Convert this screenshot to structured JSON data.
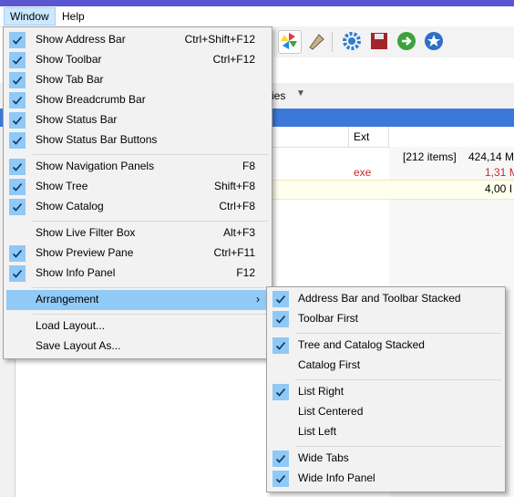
{
  "menubar": {
    "items": [
      {
        "label": "Window"
      },
      {
        "label": "Help"
      }
    ]
  },
  "background": {
    "tab_fragment": "ies",
    "column_ext": "Ext",
    "summary_count": "[212 items]",
    "summary_size": "424,14 M",
    "row1_ext": "exe",
    "row1_size": "1,31 M",
    "row2_size": "4,00 I",
    "accent_red": "#cc2a2a"
  },
  "window_menu": {
    "items": [
      {
        "label": "Show Address Bar",
        "shortcut": "Ctrl+Shift+F12",
        "checked": true
      },
      {
        "label": "Show Toolbar",
        "shortcut": "Ctrl+F12",
        "checked": true
      },
      {
        "label": "Show Tab Bar",
        "shortcut": "",
        "checked": true
      },
      {
        "label": "Show Breadcrumb Bar",
        "shortcut": "",
        "checked": true
      },
      {
        "label": "Show Status Bar",
        "shortcut": "",
        "checked": true
      },
      {
        "label": "Show Status Bar Buttons",
        "shortcut": "",
        "checked": true
      },
      {
        "label": "Show Navigation Panels",
        "shortcut": "F8",
        "checked": true
      },
      {
        "label": "Show Tree",
        "shortcut": "Shift+F8",
        "checked": true
      },
      {
        "label": "Show Catalog",
        "shortcut": "Ctrl+F8",
        "checked": true
      },
      {
        "label": "Show Live Filter Box",
        "shortcut": "Alt+F3",
        "checked": false
      },
      {
        "label": "Show Preview Pane",
        "shortcut": "Ctrl+F11",
        "checked": true
      },
      {
        "label": "Show Info Panel",
        "shortcut": "F12",
        "checked": true
      },
      {
        "label": "Arrangement",
        "shortcut": "",
        "checked": false,
        "submenu": true
      },
      {
        "label": "Load Layout...",
        "shortcut": "",
        "checked": false
      },
      {
        "label": "Save Layout As...",
        "shortcut": "",
        "checked": false
      }
    ]
  },
  "arrangement_menu": {
    "items": [
      {
        "label": "Address Bar and Toolbar Stacked",
        "checked": true
      },
      {
        "label": "Toolbar First",
        "checked": true
      },
      {
        "label": "Tree and Catalog Stacked",
        "checked": true
      },
      {
        "label": "Catalog First",
        "checked": false
      },
      {
        "label": "List Right",
        "checked": true
      },
      {
        "label": "List Centered",
        "checked": false
      },
      {
        "label": "List Left",
        "checked": false
      },
      {
        "label": "Wide Tabs",
        "checked": true
      },
      {
        "label": "Wide Info Panel",
        "checked": true
      }
    ]
  },
  "toolbar_icons": [
    "pinwheel-icon",
    "pin-icon",
    "gear-icon",
    "save-icon",
    "go-arrow-icon",
    "star-icon"
  ]
}
